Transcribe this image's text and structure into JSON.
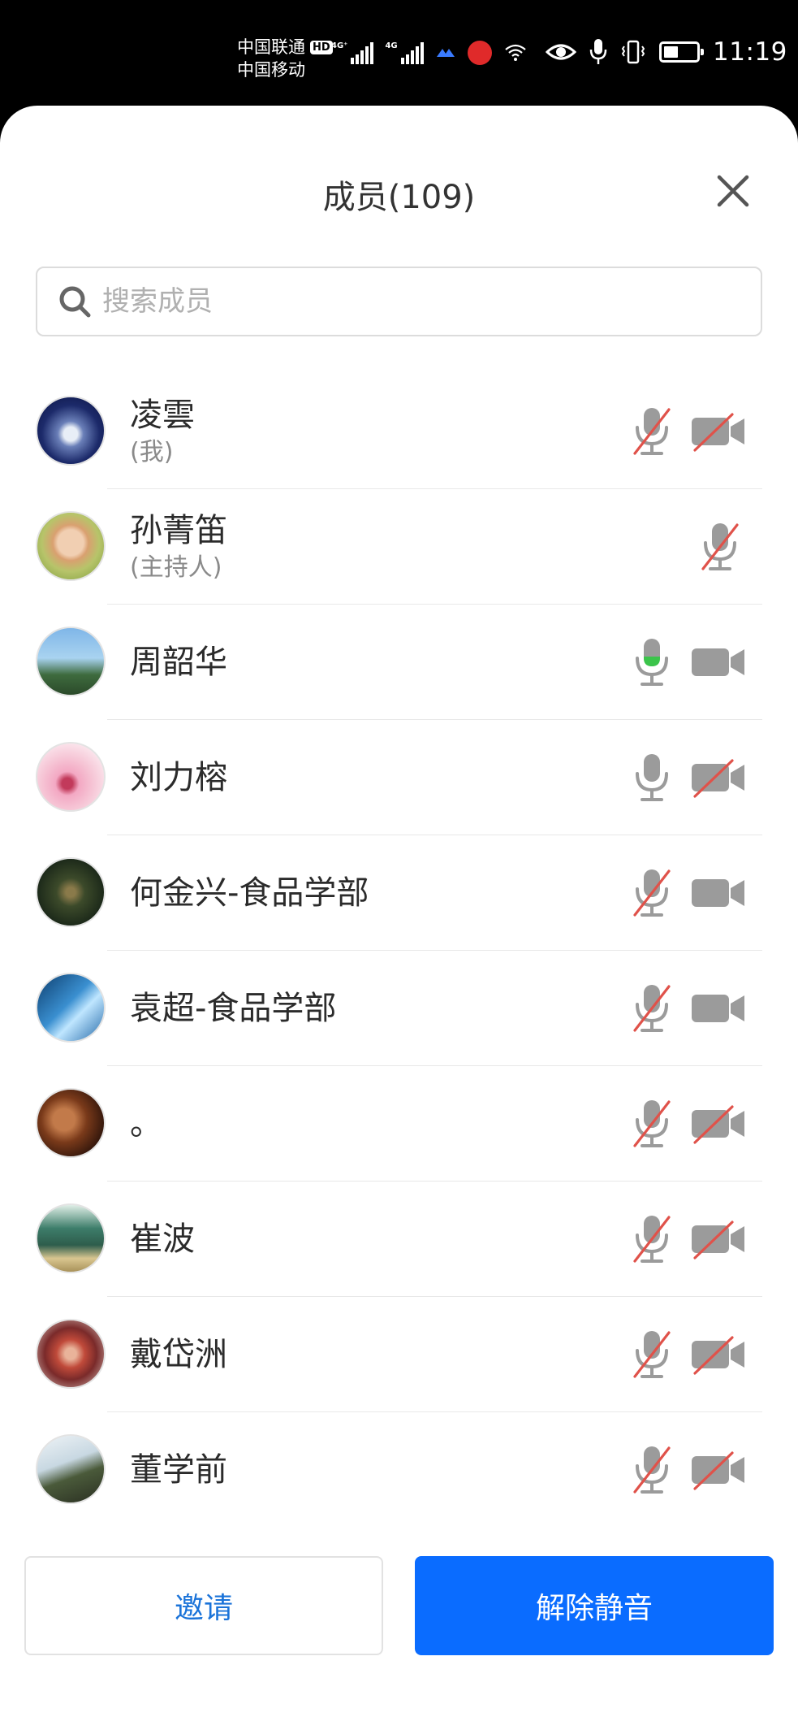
{
  "status_bar": {
    "carrier1": "中国联通",
    "hd": "HD",
    "carrier2": "中国移动",
    "net1": "4G⁺",
    "net2": "4G",
    "time": "11:19",
    "battery_level": 0.45
  },
  "header": {
    "title": "成员(109)"
  },
  "search": {
    "placeholder": "搜索成员"
  },
  "members": [
    {
      "name": "凌雲",
      "sub": "(我)",
      "mic": "muted",
      "cam": "off"
    },
    {
      "name": "孙菁笛",
      "sub": "(主持人)",
      "mic": "muted",
      "cam": "none"
    },
    {
      "name": "周韶华",
      "sub": "",
      "mic": "active",
      "cam": "on"
    },
    {
      "name": "刘力榕",
      "sub": "",
      "mic": "on",
      "cam": "off"
    },
    {
      "name": "何金兴-食品学部",
      "sub": "",
      "mic": "muted",
      "cam": "on"
    },
    {
      "name": "袁超-食品学部",
      "sub": "",
      "mic": "muted",
      "cam": "on"
    },
    {
      "name": "。",
      "sub": "",
      "mic": "muted",
      "cam": "off"
    },
    {
      "name": "崔波",
      "sub": "",
      "mic": "muted",
      "cam": "off"
    },
    {
      "name": "戴岱洲",
      "sub": "",
      "mic": "muted",
      "cam": "off"
    },
    {
      "name": "董学前",
      "sub": "",
      "mic": "muted",
      "cam": "off"
    }
  ],
  "actions": {
    "invite_label": "邀请",
    "unmute_label": "解除静音"
  },
  "colors": {
    "accent": "#0A6CFF",
    "link": "#1A73D9",
    "muted_slash": "#E0524A",
    "active_mic": "#3BC44B",
    "icon_gray": "#9B9B9B"
  }
}
